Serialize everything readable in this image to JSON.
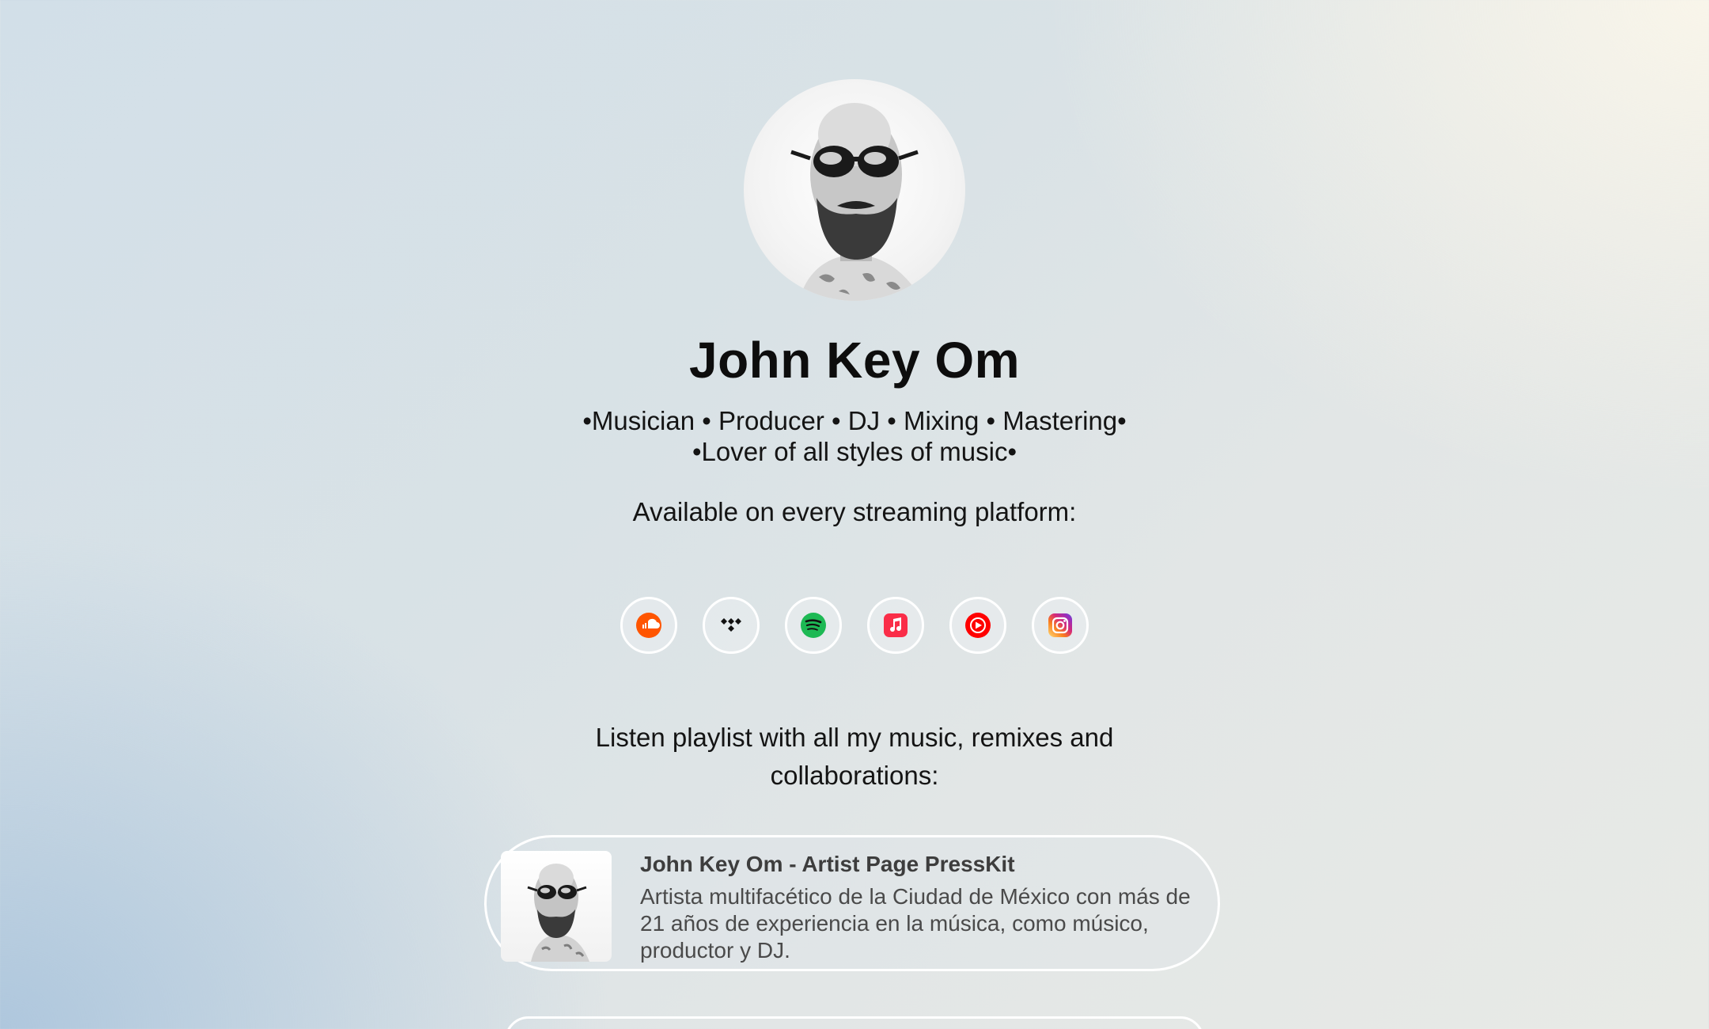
{
  "profile": {
    "name": "John Key Om",
    "bio_line1": "•Musician • Producer • DJ • Mixing • Mastering•",
    "bio_line2": "•Lover of all styles of music•",
    "availability": "Available on every streaming platform:"
  },
  "socials": [
    {
      "icon": "soundcloud-icon",
      "color": "#ff5500"
    },
    {
      "icon": "tidal-icon",
      "color": "#111111"
    },
    {
      "icon": "spotify-icon",
      "color": "#1db954"
    },
    {
      "icon": "apple-music-icon",
      "color": "#fa2d48"
    },
    {
      "icon": "youtube-music-icon",
      "color": "#ff0000"
    },
    {
      "icon": "instagram-icon",
      "color": "#d6249f"
    }
  ],
  "listen_text": "Listen playlist with all my music, remixes and collaborations:",
  "link_card": {
    "title": "John Key Om - Artist Page PressKit",
    "description": "Artista multifacético de la Ciudad de México con más de 21 años de experiencia en la música, como músico, productor y DJ."
  }
}
